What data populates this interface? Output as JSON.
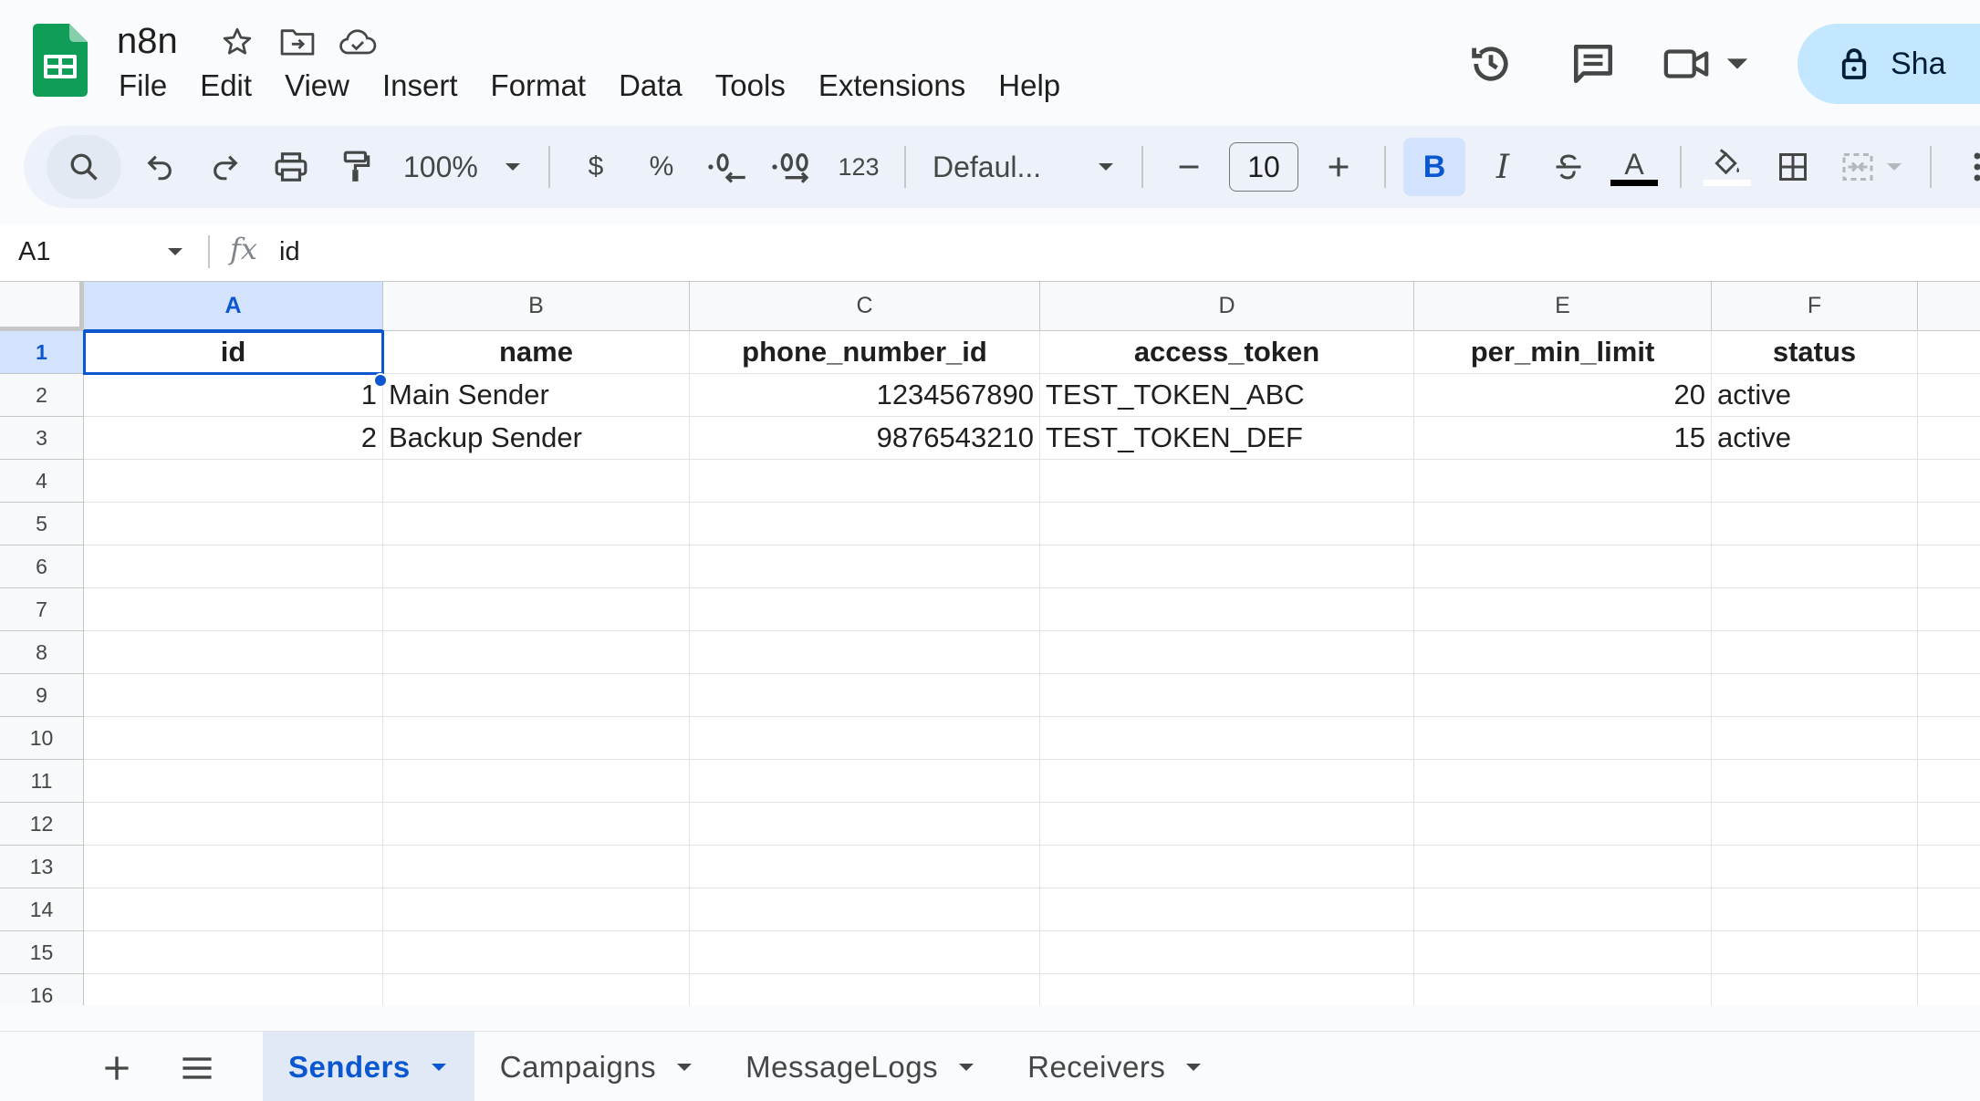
{
  "app": {
    "doc_title": "n8n",
    "menu": [
      "File",
      "Edit",
      "View",
      "Insert",
      "Format",
      "Data",
      "Tools",
      "Extensions",
      "Help"
    ],
    "share_label": "Sha"
  },
  "toolbar": {
    "zoom": "100%",
    "currency": "$",
    "percent": "%",
    "dec_decrease": ".0",
    "dec_increase": ".00",
    "number_format": "123",
    "font": "Defaul...",
    "font_size": "10",
    "bold": "B",
    "italic": "I",
    "text_color": "A"
  },
  "formula_bar": {
    "cell_ref": "A1",
    "fx": "fx",
    "value": "id"
  },
  "sheet": {
    "columns": [
      "A",
      "B",
      "C",
      "D",
      "E",
      "F"
    ],
    "rows": [
      "1",
      "2",
      "3",
      "4",
      "5",
      "6",
      "7",
      "8",
      "9",
      "10",
      "11",
      "12",
      "13",
      "14",
      "15",
      "16"
    ],
    "header": [
      "id",
      "name",
      "phone_number_id",
      "access_token",
      "per_min_limit",
      "status"
    ],
    "data": [
      [
        "1",
        "Main Sender",
        "1234567890",
        "TEST_TOKEN_ABC",
        "20",
        "active"
      ],
      [
        "2",
        "Backup Sender",
        "9876543210",
        "TEST_TOKEN_DEF",
        "15",
        "active"
      ]
    ]
  },
  "tabs": [
    {
      "label": "Senders",
      "active": true
    },
    {
      "label": "Campaigns",
      "active": false
    },
    {
      "label": "MessageLogs",
      "active": false
    },
    {
      "label": "Receivers",
      "active": false
    }
  ],
  "colors": {
    "accent": "#0b57d0",
    "selection": "#d3e3fd",
    "share": "#c2e7ff",
    "sheets_green": "#0f9d58"
  }
}
